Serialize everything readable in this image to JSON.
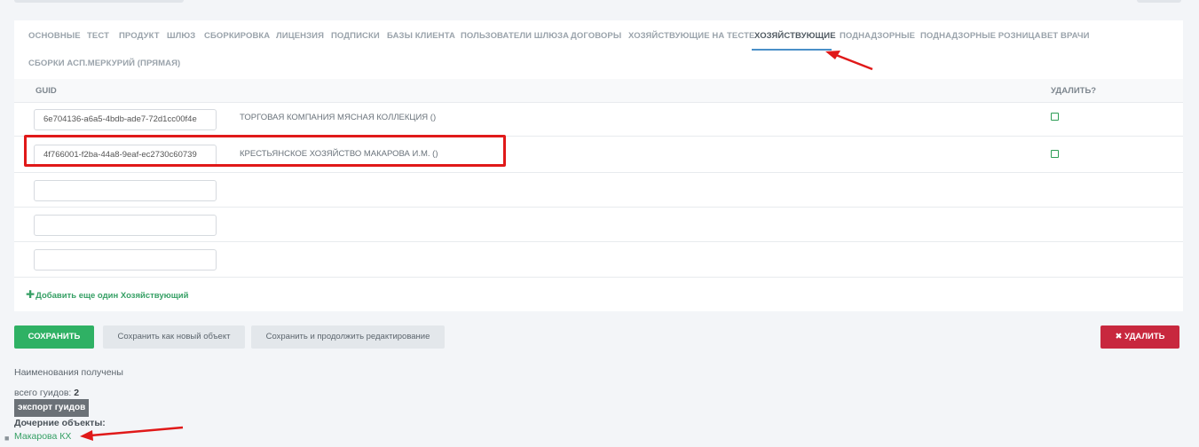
{
  "tabs": [
    {
      "label": "Основные"
    },
    {
      "label": "Тест"
    },
    {
      "label": "Продукт"
    },
    {
      "label": "Шлюз"
    },
    {
      "label": "Сборкировка"
    },
    {
      "label": "Лицензия"
    },
    {
      "label": "Подписки"
    },
    {
      "label": "Базы клиента"
    },
    {
      "label": "Пользователи шлюза"
    },
    {
      "label": "Договоры"
    },
    {
      "label": "Хозяйствующие на тесте"
    },
    {
      "label": "Хозяйствующие"
    },
    {
      "label": "Поднадзорные"
    },
    {
      "label": "Поднадзорные розница"
    },
    {
      "label": "Вет врачи"
    },
    {
      "label": "Сборки асп.меркурий (прямая)"
    }
  ],
  "active_tab": "Хозяйствующие",
  "table": {
    "headers": {
      "guid": "GUID",
      "delete": "Удалить?"
    },
    "rows": [
      {
        "guid": "6e704136-a6a5-4bdb-ade7-72d1cc00f4e",
        "name": "Торговая компания мясная коллекция ()"
      },
      {
        "guid": "4f766001-f2ba-44a8-9eaf-ec2730c60739",
        "name": "Крестьянское хозяйство Макарова И.М. ()"
      },
      {
        "guid": "",
        "name": ""
      },
      {
        "guid": "",
        "name": ""
      },
      {
        "guid": "",
        "name": ""
      }
    ],
    "add_link": "Добавить еще один Хозяйствующий"
  },
  "buttons": {
    "save": "Сохранить",
    "save_as_new": "Сохранить как новый объект",
    "save_continue": "Сохранить и продолжить редактирование",
    "delete": "Удалить"
  },
  "info": {
    "names_received": "Наименования получены",
    "total_guids_label": "всего гуидов:",
    "total_guids_value": "2",
    "export_label": "экспорт гуидов",
    "child_objects_label": "Дочерние объекты:",
    "child_link": "Макарова КХ"
  },
  "colors": {
    "accent_green": "#2fb164",
    "delete_red": "#c8283e",
    "annotation_red": "#e01919",
    "tab_underline": "#4a90c8"
  }
}
